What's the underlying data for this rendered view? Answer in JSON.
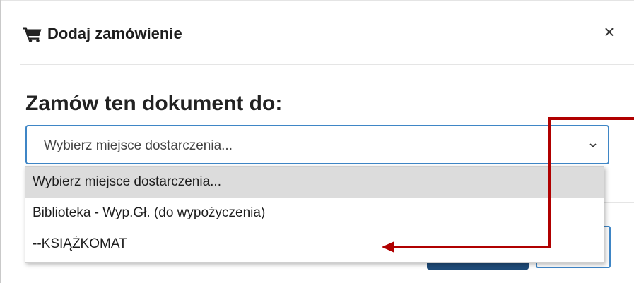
{
  "modal": {
    "title": "Dodaj zamówienie",
    "title_icon": "shopping-cart-icon",
    "close_label": "×",
    "close_icon": "close-icon"
  },
  "order_form": {
    "heading": "Zamów ten dokument do:",
    "delivery_select": {
      "value": "Wybierz miejsce dostarczenia...",
      "chevron_icon": "chevron-down-icon",
      "options": [
        {
          "label": "Wybierz miejsce dostarczenia...",
          "selected": true
        },
        {
          "label": "Biblioteka - Wyp.Gł. (do wypożyczenia)",
          "selected": false
        },
        {
          "label": "--KSIĄŻKOMAT",
          "selected": false
        }
      ]
    }
  },
  "annotation": {
    "icon": "arrow-annotation-icon",
    "color": "#b00000",
    "points_to": "--KSIĄŻKOMAT"
  },
  "colors": {
    "accent": "#3f86c6",
    "primary_button": "#1f4b78",
    "selected_option_bg": "#dcdcdc"
  }
}
